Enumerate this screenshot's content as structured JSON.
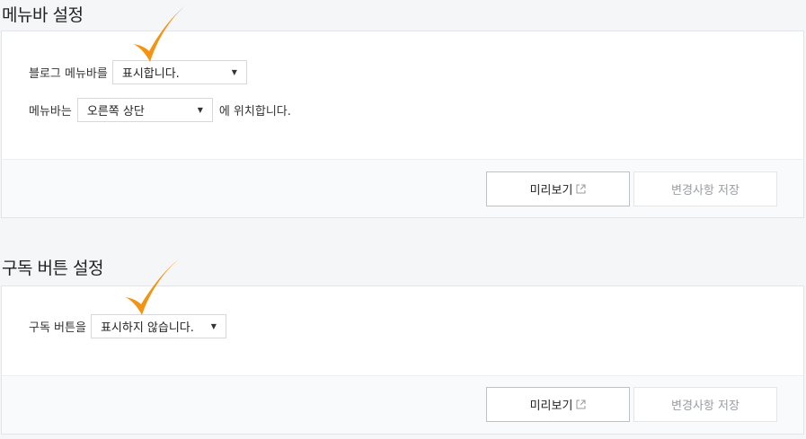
{
  "menubar": {
    "title": "메뉴바 설정",
    "show_label": "블로그 메뉴바를",
    "show_value": "표시합니다.",
    "position_label": "메뉴바는",
    "position_value": "오른쪽 상단",
    "position_suffix": "에 위치합니다.",
    "preview_label": "미리보기",
    "save_label": "변경사항 저장"
  },
  "subscribe": {
    "title": "구독 버튼 설정",
    "label": "구독 버튼을",
    "value": "표시하지 않습니다.",
    "preview_label": "미리보기",
    "save_label": "변경사항 저장"
  },
  "colors": {
    "annotation_check": "#f39314"
  }
}
